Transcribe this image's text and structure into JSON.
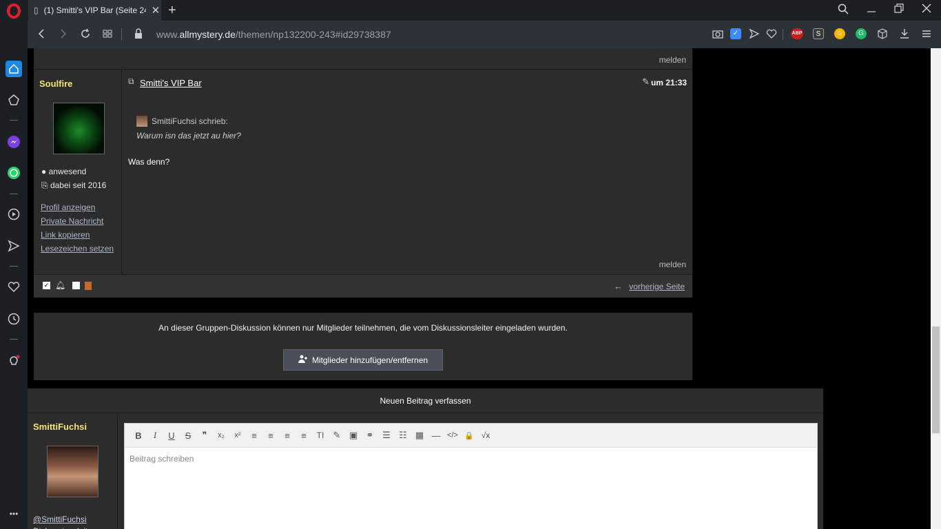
{
  "browser": {
    "tab_title": "(1) Smitti's VIP Bar (Seite 24",
    "tab_close": "✕",
    "new_tab": "+",
    "url_prefix": "www.",
    "url_domain": "allmystery.de",
    "url_path": "/themen/np132200-243#id29738387",
    "ext_abp": "ABP",
    "more": "•••"
  },
  "post": {
    "melden_top": "melden",
    "author": "Soulfire",
    "status_online": "anwesend",
    "member_since": "dabei seit 2016",
    "links": [
      "Profil anzeigen",
      "Private Nachricht",
      "Link kopieren",
      "Lesezeichen setzen"
    ],
    "thread_title": "Smitti's VIP Bar",
    "time": "um 21:33",
    "quote_author": "SmittiFuchsi schrieb:",
    "quote_text": "Warum isn das jetzt au hier?",
    "body": "Was denn?",
    "melden_bottom": "melden",
    "prev_page": "vorherige Seite"
  },
  "group": {
    "message": "An dieser Gruppen-Diskussion können nur Mitglieder teilnehmen, die vom Diskussionsleiter eingeladen wurden.",
    "button_label": "Mitglieder hinzufügen/entfernen"
  },
  "new_post": {
    "heading": "Neuen Beitrag verfassen",
    "user": "SmittiFuchsi",
    "mention": "@SmittiFuchsi",
    "role": "Diskussionsleiter",
    "placeholder": "Beitrag schreiben",
    "toolbar": [
      "B",
      "I",
      "U",
      "S",
      "❞",
      "x₂",
      "x²",
      "≡",
      "≡",
      "≡",
      "≡",
      "TI",
      "✎",
      "▣",
      "⚭",
      "☰",
      "☷",
      "▦",
      "—",
      "</>",
      "🔒",
      "√x"
    ]
  }
}
